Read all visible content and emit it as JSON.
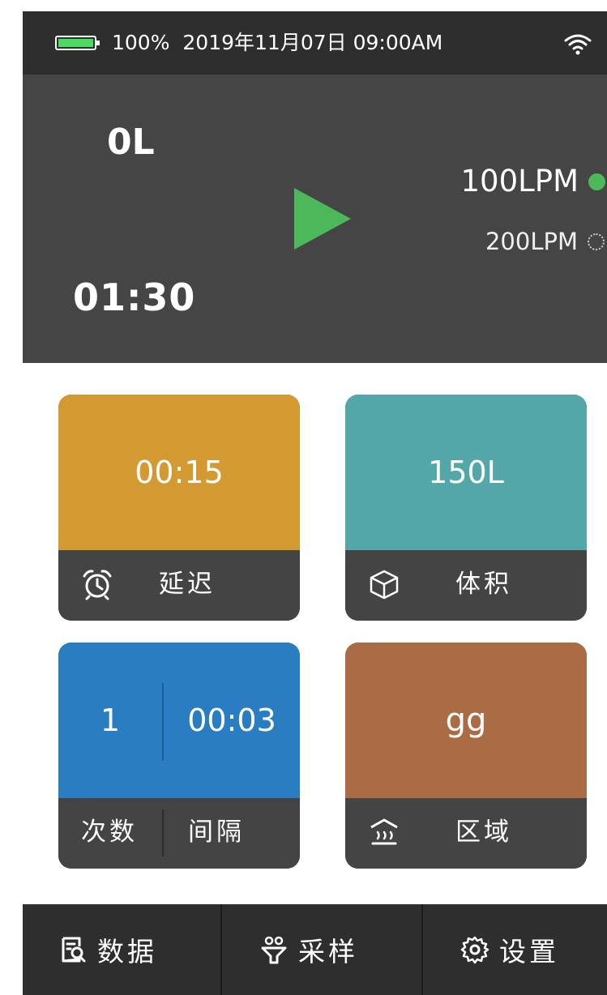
{
  "status_bar": {
    "battery_percent": "100%",
    "date": "2019年11月07日",
    "time": "09:00AM",
    "battery_icon": "battery-full-icon",
    "wifi_icon": "wifi-icon"
  },
  "panel": {
    "volume": "0L",
    "elapsed_time": "01:30",
    "play_icon": "play-icon",
    "flow_rates": [
      {
        "label": "100LPM",
        "selected": true
      },
      {
        "label": "200LPM",
        "selected": false
      }
    ]
  },
  "tiles": {
    "delay": {
      "value": "00:15",
      "label": "延迟",
      "icon": "alarm-clock-icon"
    },
    "volume": {
      "value": "150L",
      "label": "体积",
      "icon": "cube-icon"
    },
    "count_interval": {
      "count": "1",
      "interval": "00:03",
      "count_label": "次数",
      "interval_label": "间隔"
    },
    "zone": {
      "value": "gg",
      "label": "区域",
      "icon": "building-icon"
    }
  },
  "bottom_nav": {
    "items": [
      {
        "label": "数据",
        "icon": "data-search-icon"
      },
      {
        "label": "采样",
        "icon": "sampling-icon"
      },
      {
        "label": "设置",
        "icon": "gear-icon"
      }
    ]
  },
  "colors": {
    "status_bar": "#2e2e2e",
    "panel": "#454545",
    "accent_green": "#4cb85a",
    "delay_tile": "#d49a32",
    "volume_tile": "#53a7a8",
    "count_tile": "#2a7dc1",
    "zone_tile": "#ab6c45",
    "tile_footer": "#444444"
  }
}
